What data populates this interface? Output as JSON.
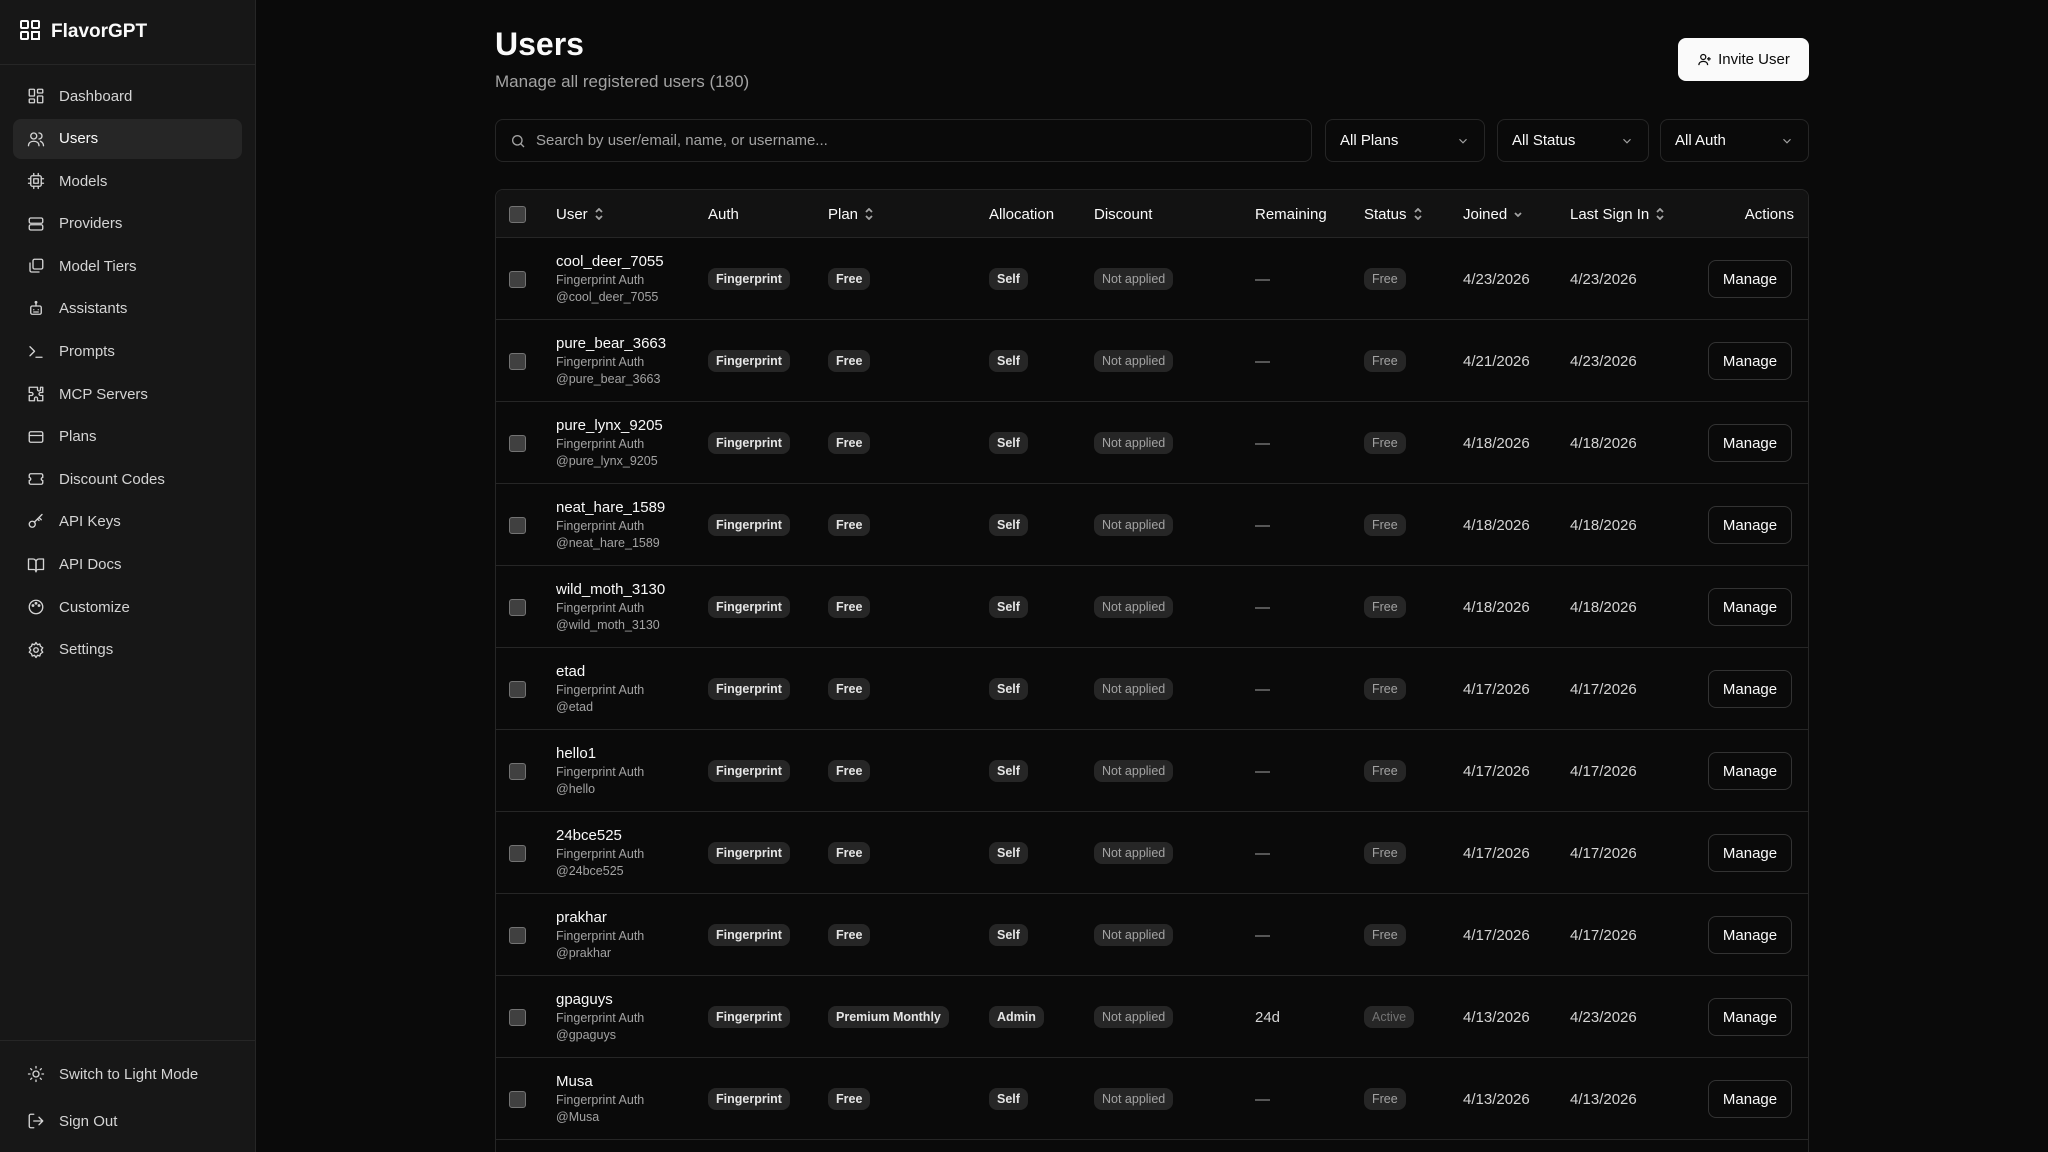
{
  "app": {
    "name": "FlavorGPT"
  },
  "sidebar": {
    "items": [
      {
        "label": "Dashboard",
        "icon": "dashboard-icon"
      },
      {
        "label": "Users",
        "icon": "users-icon",
        "active": true
      },
      {
        "label": "Models",
        "icon": "cpu-icon"
      },
      {
        "label": "Providers",
        "icon": "server-icon"
      },
      {
        "label": "Model Tiers",
        "icon": "layers-icon"
      },
      {
        "label": "Assistants",
        "icon": "bot-icon"
      },
      {
        "label": "Prompts",
        "icon": "terminal-icon"
      },
      {
        "label": "MCP Servers",
        "icon": "puzzle-icon"
      },
      {
        "label": "Plans",
        "icon": "credit-card-icon"
      },
      {
        "label": "Discount Codes",
        "icon": "ticket-icon"
      },
      {
        "label": "API Keys",
        "icon": "key-icon"
      },
      {
        "label": "API Docs",
        "icon": "book-icon"
      },
      {
        "label": "Customize",
        "icon": "palette-icon"
      },
      {
        "label": "Settings",
        "icon": "gear-icon"
      }
    ],
    "bottom": {
      "theme_toggle": "Switch to Light Mode",
      "sign_out": "Sign Out"
    }
  },
  "page": {
    "title": "Users",
    "subtitle": "Manage all registered users (180)",
    "invite_label": "Invite User"
  },
  "filters": {
    "search_placeholder": "Search by user/email, name, or username...",
    "plans": "All Plans",
    "status": "All Status",
    "auth": "All Auth"
  },
  "table": {
    "headers": {
      "user": "User",
      "auth": "Auth",
      "plan": "Plan",
      "allocation": "Allocation",
      "discount": "Discount",
      "remaining": "Remaining",
      "status": "Status",
      "joined": "Joined",
      "last_sign_in": "Last Sign In",
      "actions": "Actions"
    },
    "manage_label": "Manage",
    "rows": [
      {
        "name": "cool_deer_7055",
        "auth_sub": "Fingerprint Auth",
        "handle": "@cool_deer_7055",
        "auth": "Fingerprint",
        "plan": "Free",
        "allocation": "Self",
        "discount": "Not applied",
        "remaining": "—",
        "status": "Free",
        "joined": "4/23/2026",
        "last_sign_in": "4/23/2026"
      },
      {
        "name": "pure_bear_3663",
        "auth_sub": "Fingerprint Auth",
        "handle": "@pure_bear_3663",
        "auth": "Fingerprint",
        "plan": "Free",
        "allocation": "Self",
        "discount": "Not applied",
        "remaining": "—",
        "status": "Free",
        "joined": "4/21/2026",
        "last_sign_in": "4/23/2026"
      },
      {
        "name": "pure_lynx_9205",
        "auth_sub": "Fingerprint Auth",
        "handle": "@pure_lynx_9205",
        "auth": "Fingerprint",
        "plan": "Free",
        "allocation": "Self",
        "discount": "Not applied",
        "remaining": "—",
        "status": "Free",
        "joined": "4/18/2026",
        "last_sign_in": "4/18/2026"
      },
      {
        "name": "neat_hare_1589",
        "auth_sub": "Fingerprint Auth",
        "handle": "@neat_hare_1589",
        "auth": "Fingerprint",
        "plan": "Free",
        "allocation": "Self",
        "discount": "Not applied",
        "remaining": "—",
        "status": "Free",
        "joined": "4/18/2026",
        "last_sign_in": "4/18/2026"
      },
      {
        "name": "wild_moth_3130",
        "auth_sub": "Fingerprint Auth",
        "handle": "@wild_moth_3130",
        "auth": "Fingerprint",
        "plan": "Free",
        "allocation": "Self",
        "discount": "Not applied",
        "remaining": "—",
        "status": "Free",
        "joined": "4/18/2026",
        "last_sign_in": "4/18/2026"
      },
      {
        "name": "etad",
        "auth_sub": "Fingerprint Auth",
        "handle": "@etad",
        "auth": "Fingerprint",
        "plan": "Free",
        "allocation": "Self",
        "discount": "Not applied",
        "remaining": "—",
        "status": "Free",
        "joined": "4/17/2026",
        "last_sign_in": "4/17/2026"
      },
      {
        "name": "hello1",
        "auth_sub": "Fingerprint Auth",
        "handle": "@hello",
        "auth": "Fingerprint",
        "plan": "Free",
        "allocation": "Self",
        "discount": "Not applied",
        "remaining": "—",
        "status": "Free",
        "joined": "4/17/2026",
        "last_sign_in": "4/17/2026"
      },
      {
        "name": "24bce525",
        "auth_sub": "Fingerprint Auth",
        "handle": "@24bce525",
        "auth": "Fingerprint",
        "plan": "Free",
        "allocation": "Self",
        "discount": "Not applied",
        "remaining": "—",
        "status": "Free",
        "joined": "4/17/2026",
        "last_sign_in": "4/17/2026"
      },
      {
        "name": "prakhar",
        "auth_sub": "Fingerprint Auth",
        "handle": "@prakhar",
        "auth": "Fingerprint",
        "plan": "Free",
        "allocation": "Self",
        "discount": "Not applied",
        "remaining": "—",
        "status": "Free",
        "joined": "4/17/2026",
        "last_sign_in": "4/17/2026"
      },
      {
        "name": "gpaguys",
        "auth_sub": "Fingerprint Auth",
        "handle": "@gpaguys",
        "auth": "Fingerprint",
        "plan": "Premium Monthly",
        "allocation": "Admin",
        "discount": "Not applied",
        "remaining": "24d",
        "status": "Active",
        "joined": "4/13/2026",
        "last_sign_in": "4/23/2026"
      },
      {
        "name": "Musa",
        "auth_sub": "Fingerprint Auth",
        "handle": "@Musa",
        "auth": "Fingerprint",
        "plan": "Free",
        "allocation": "Self",
        "discount": "Not applied",
        "remaining": "—",
        "status": "Free",
        "joined": "4/13/2026",
        "last_sign_in": "4/13/2026"
      }
    ]
  }
}
